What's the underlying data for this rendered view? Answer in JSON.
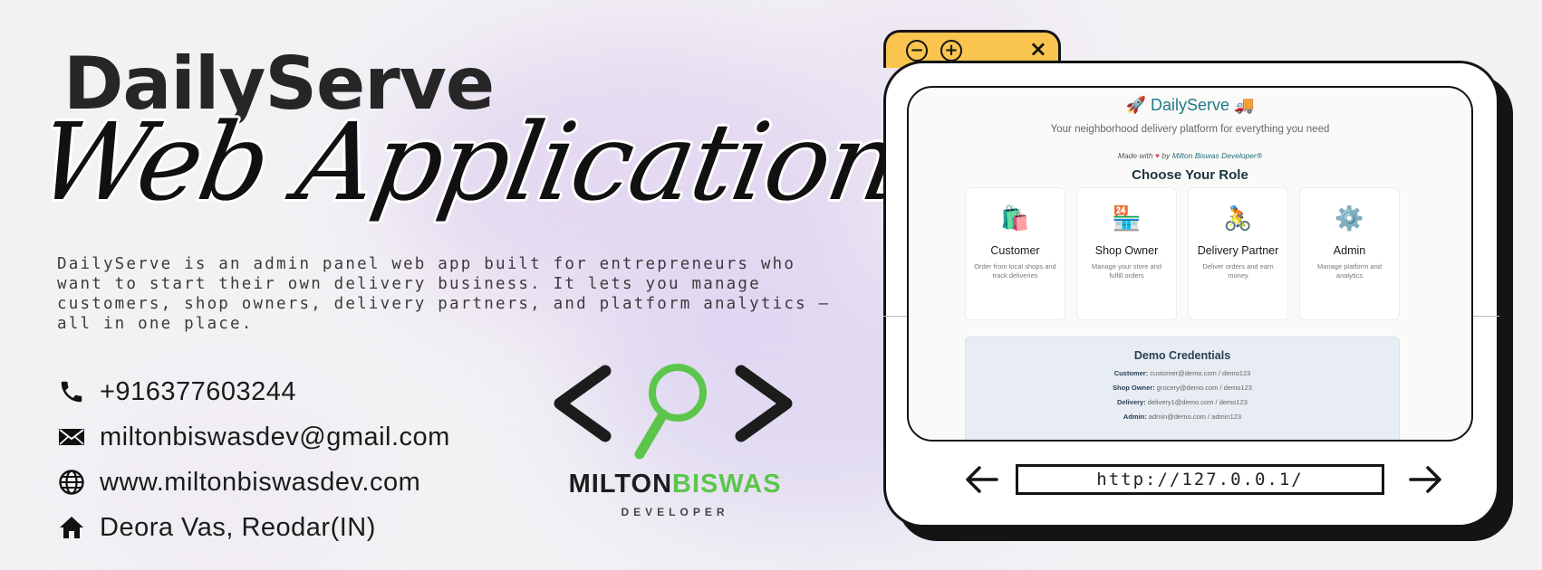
{
  "banner": {
    "title": "DailyServe",
    "script_title": "Web Application",
    "description": "DailyServe is an admin panel web app built for entrepreneurs who want to start their own delivery business. It lets you manage customers, shop owners, delivery partners, and platform analytics — all in one place."
  },
  "contacts": [
    {
      "icon": "phone-icon",
      "text": "+916377603244"
    },
    {
      "icon": "mail-icon",
      "text": "miltonbiswasdev@gmail.com"
    },
    {
      "icon": "globe-icon",
      "text": "www.miltonbiswasdev.com"
    },
    {
      "icon": "home-icon",
      "text": "Deora Vas, Reodar(IN)"
    }
  ],
  "logo": {
    "name_first": "MILTON",
    "name_second": "BISWAS",
    "subtitle": "DEVELOPER",
    "colors": {
      "dark": "#1c1c1c",
      "accent": "#5cc64c"
    }
  },
  "browser": {
    "tab_buttons": [
      "−",
      "+"
    ],
    "close": "×",
    "url": "http://127.0.0.1/",
    "tab_color": "#f9c54f"
  },
  "app": {
    "title": "🚀 DailyServe 🚚",
    "subtitle": "Your neighborhood delivery platform for everything you need",
    "made_with": "Made with",
    "made_by": "by",
    "author": "Milton Biswas Developer®",
    "role_heading": "Choose Your Role",
    "roles": [
      {
        "icon": "🛍️",
        "title": "Customer",
        "desc": "Order from local shops and track deliveries"
      },
      {
        "icon": "🏪",
        "title": "Shop Owner",
        "desc": "Manage your store and fulfill orders"
      },
      {
        "icon": "🚴",
        "title": "Delivery Partner",
        "desc": "Deliver orders and earn money"
      },
      {
        "icon": "⚙️",
        "title": "Admin",
        "desc": "Manage platform and analytics"
      }
    ],
    "demo": {
      "title": "Demo Credentials",
      "rows": [
        {
          "label": "Customer:",
          "value": "customer@demo.com / demo123"
        },
        {
          "label": "Shop Owner:",
          "value": "grocery@demo.com / demo123"
        },
        {
          "label": "Delivery:",
          "value": "delivery1@demo.com / demo123"
        },
        {
          "label": "Admin:",
          "value": "admin@demo.com / admin123"
        }
      ]
    }
  }
}
